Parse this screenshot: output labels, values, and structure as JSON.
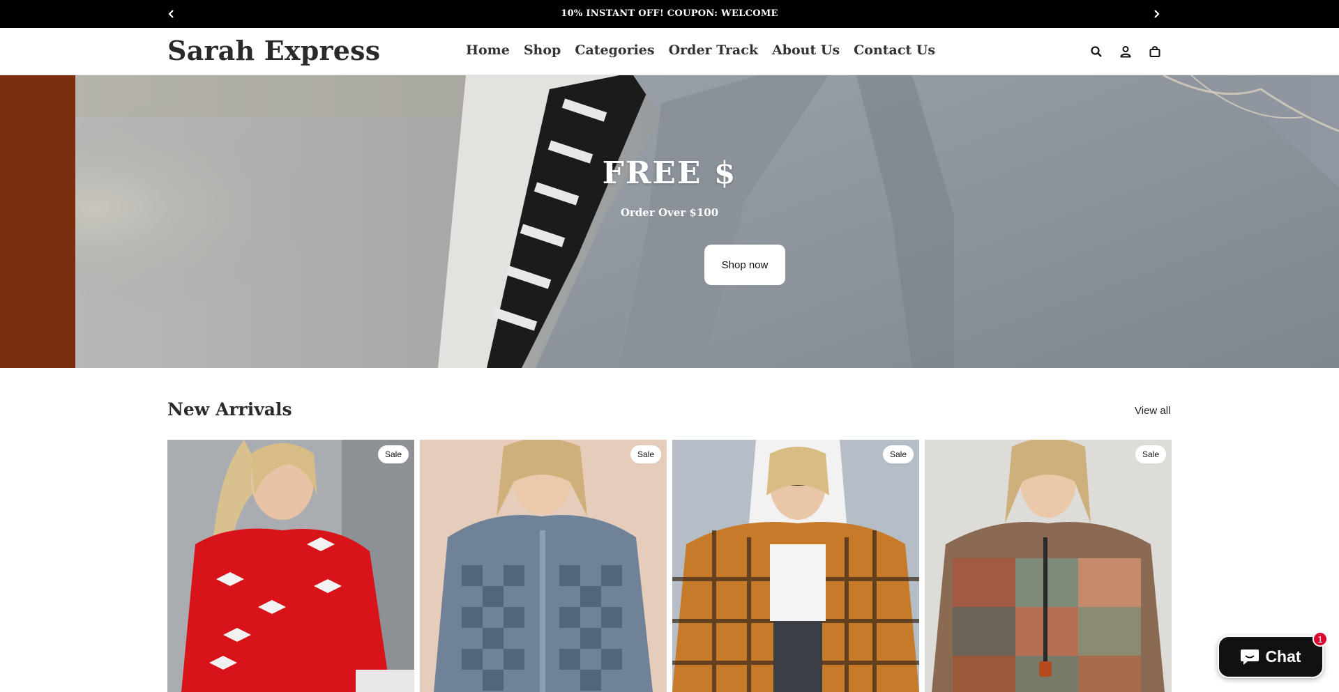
{
  "announcement": {
    "text": "10% INSTANT OFF! COUPON: WELCOME",
    "prev_icon": "chevron-left-icon",
    "next_icon": "chevron-right-icon"
  },
  "header": {
    "logo": "Sarah Express",
    "nav": [
      "Home",
      "Shop",
      "Categories",
      "Order Track",
      "About Us",
      "Contact Us"
    ],
    "icons": [
      "search-icon",
      "account-icon",
      "cart-icon"
    ]
  },
  "hero": {
    "title": "FREE $",
    "subtitle": "Order Over $100",
    "button": "Shop now",
    "colors": {
      "side_panel": "#7a2e0e",
      "coat": "#8e969e"
    }
  },
  "new_arrivals": {
    "title": "New Arrivals",
    "view_all": "View all",
    "products": [
      {
        "badge": "Sale",
        "image": "woman in red sweater with white bows"
      },
      {
        "badge": "Sale",
        "image": "woman in checkered denim jacket"
      },
      {
        "badge": "Sale",
        "image": "woman in orange plaid hooded shirt"
      },
      {
        "badge": "Sale",
        "image": "woman in patchwork plaid pullover"
      }
    ]
  },
  "chat": {
    "label": "Chat",
    "count": "1",
    "icon": "chat-bubble-icon"
  }
}
